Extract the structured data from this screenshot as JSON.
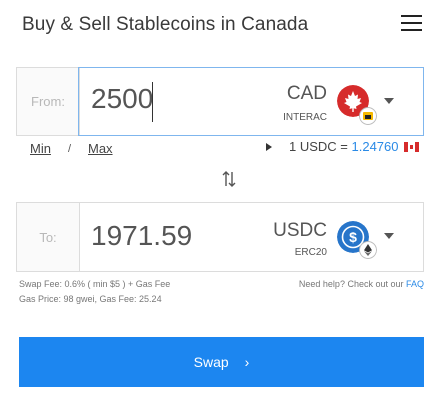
{
  "header": {
    "title": "Buy & Sell Stablecoins in Canada"
  },
  "from": {
    "label": "From:",
    "amount": "2500",
    "currency": "CAD",
    "network": "INTERAC"
  },
  "limits": {
    "min": "Min",
    "separator": "/",
    "max": "Max"
  },
  "rate": {
    "prefix": "1 USDC = ",
    "value": "1.24760"
  },
  "to": {
    "label": "To:",
    "amount": "1971.59",
    "currency": "USDC",
    "network": "ERC20"
  },
  "fees": {
    "swap_fee": "Swap Fee: 0.6% ( min $5 ) + Gas Fee",
    "gas": "Gas Price: 98 gwei, Gas Fee: 25.24"
  },
  "help": {
    "text": "Need help? Check out our ",
    "link": "FAQ"
  },
  "swap": {
    "label": "Swap",
    "arrow": "›"
  },
  "colors": {
    "accent": "#1c86f0",
    "link": "#2a8ae6",
    "cad_red": "#d62b2b",
    "usdc_blue": "#2775ca"
  }
}
